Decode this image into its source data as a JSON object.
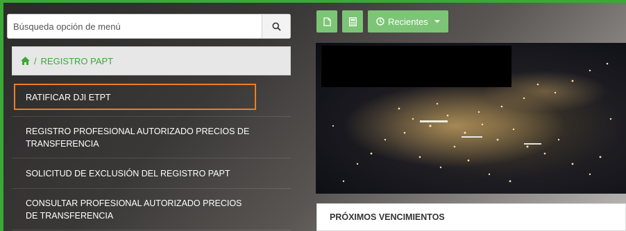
{
  "search": {
    "placeholder": "Búsqueda opción de menú"
  },
  "breadcrumb": {
    "separator": "/",
    "current": "REGISTRO PAPT"
  },
  "menu": {
    "items": [
      {
        "label": "RATIFICAR DJI ETPT"
      },
      {
        "label": "REGISTRO PROFESIONAL AUTORIZADO PRECIOS DE TRANSFERENCIA"
      },
      {
        "label": "SOLICITUD DE EXCLUSIÓN DEL REGISTRO PAPT"
      },
      {
        "label": "CONSULTAR PROFESIONAL AUTORIZADO PRECIOS DE TRANSFERENCIA"
      }
    ]
  },
  "toolbar": {
    "recientes_label": "Recientes"
  },
  "panel": {
    "title": "PRÓXIMOS VENCIMIENTOS"
  },
  "colors": {
    "accent_green": "#3aa935",
    "button_green": "#7cc576",
    "highlight_orange": "#ef7d22"
  },
  "icons": [
    "search-icon",
    "home-icon",
    "file-icon",
    "calculator-icon",
    "clock-icon",
    "caret-down-icon"
  ]
}
